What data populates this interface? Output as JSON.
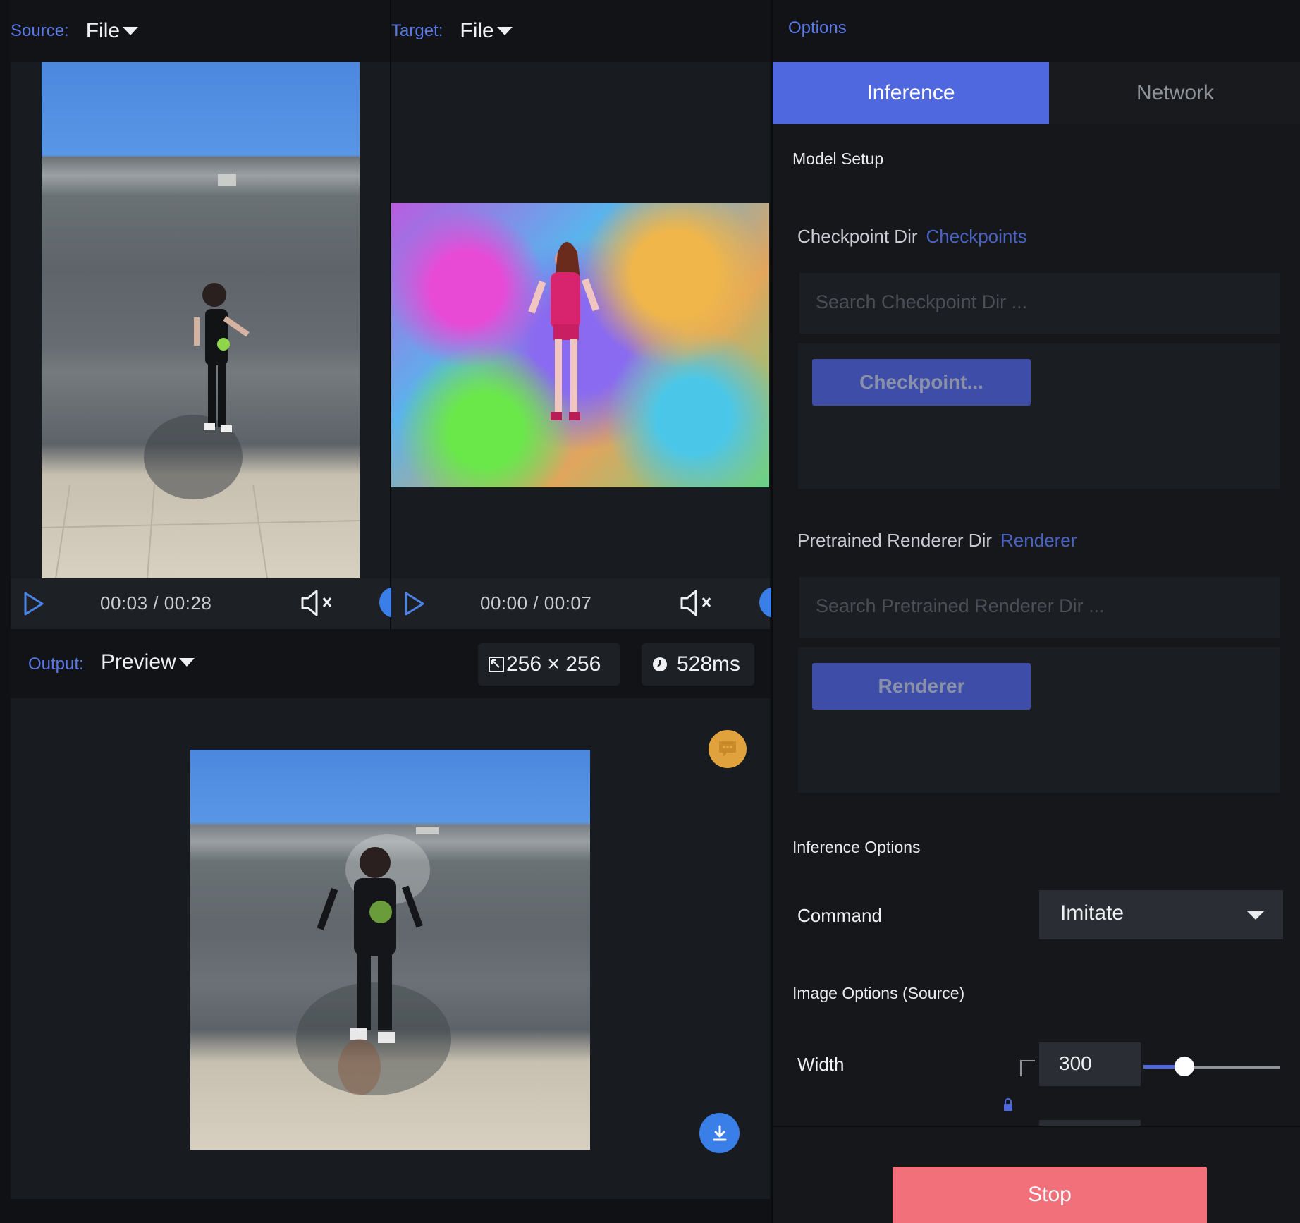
{
  "source": {
    "label": "Source:",
    "value": "File",
    "time": "00:03 / 00:28"
  },
  "target": {
    "label": "Target:",
    "value": "File",
    "time": "00:00 / 00:07"
  },
  "output": {
    "label": "Output:",
    "value": "Preview",
    "resolution": "256 × 256",
    "latency": "528ms"
  },
  "options": {
    "title": "Options",
    "tabs": [
      {
        "label": "Inference",
        "active": true
      },
      {
        "label": "Network",
        "active": false
      }
    ],
    "model_setup": {
      "title": "Model Setup",
      "checkpoint": {
        "label": "Checkpoint Dir",
        "link": "Checkpoints",
        "placeholder": "Search Checkpoint Dir ...",
        "button": "Checkpoint..."
      },
      "renderer": {
        "label": "Pretrained Renderer Dir",
        "link": "Renderer",
        "placeholder": "Search Pretrained Renderer Dir ...",
        "button": "Renderer"
      }
    },
    "inference_options": {
      "title": "Inference Options",
      "command_label": "Command",
      "command_value": "Imitate"
    },
    "image_options": {
      "title": "Image Options (Source)",
      "width_label": "Width",
      "width_value": "300",
      "width_slider_fraction": 0.3
    },
    "stop_label": "Stop"
  },
  "colors": {
    "accent": "#4f67df",
    "stop": "#f2707a",
    "label_blue": "#5b79e6",
    "chat_fab": "#e0a23c",
    "download_fab": "#3a7ee8"
  }
}
